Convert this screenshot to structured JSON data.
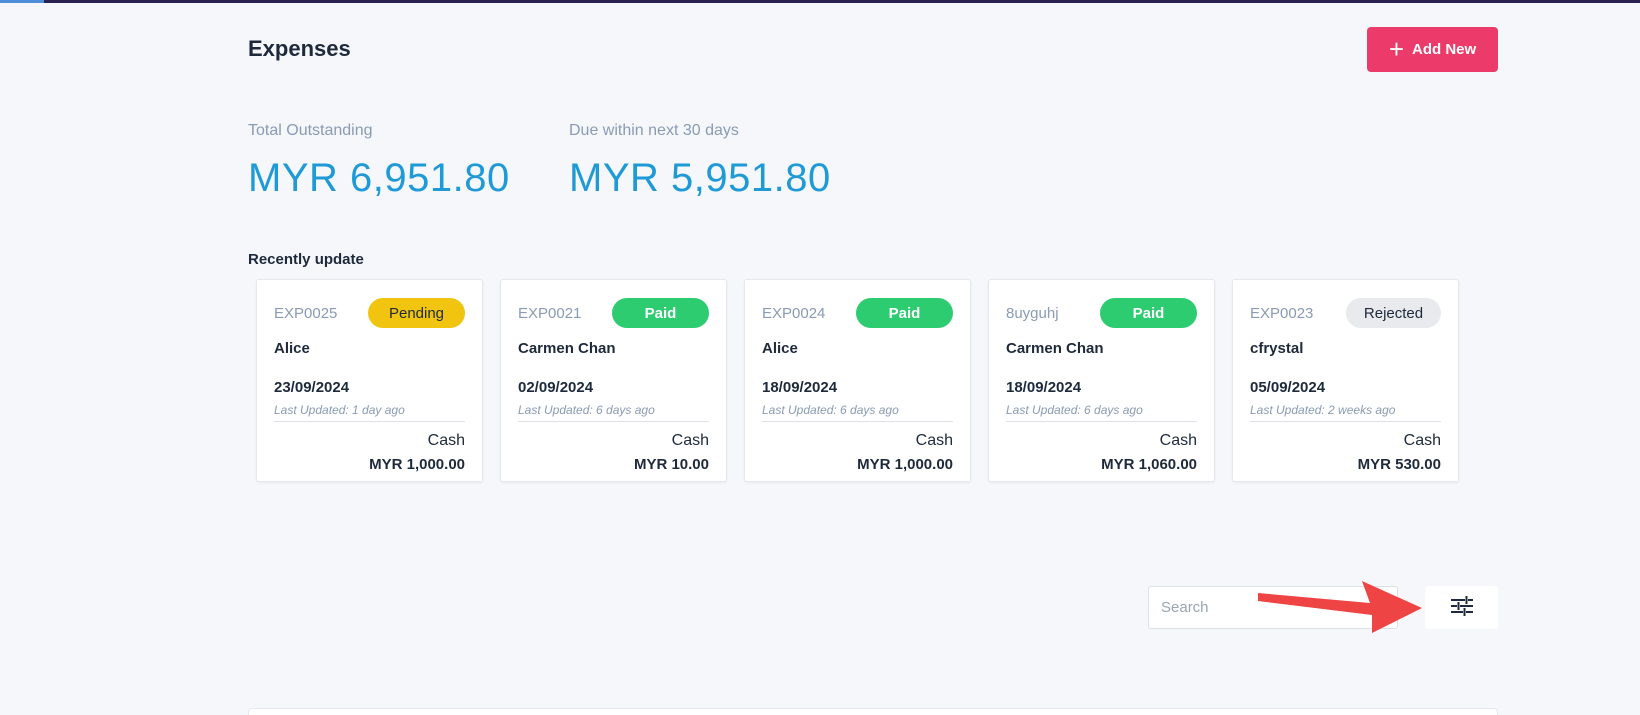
{
  "page": {
    "title": "Expenses",
    "add_label": "Add New"
  },
  "stats": {
    "outstanding_label": "Total Outstanding",
    "outstanding_value": "MYR 6,951.80",
    "due_label": "Due within next 30 days",
    "due_value": "MYR 5,951.80"
  },
  "recent": {
    "title": "Recently update",
    "cards": [
      {
        "id": "EXP0025",
        "status": "Pending",
        "name": "Alice",
        "date": "23/09/2024",
        "updated": "Last Updated: 1 day ago",
        "method": "Cash",
        "amount": "MYR 1,000.00"
      },
      {
        "id": "EXP0021",
        "status": "Paid",
        "name": "Carmen Chan",
        "date": "02/09/2024",
        "updated": "Last Updated: 6 days ago",
        "method": "Cash",
        "amount": "MYR 10.00"
      },
      {
        "id": "EXP0024",
        "status": "Paid",
        "name": "Alice",
        "date": "18/09/2024",
        "updated": "Last Updated: 6 days ago",
        "method": "Cash",
        "amount": "MYR 1,000.00"
      },
      {
        "id": "8uyguhj",
        "status": "Paid",
        "name": "Carmen Chan",
        "date": "18/09/2024",
        "updated": "Last Updated: 6 days ago",
        "method": "Cash",
        "amount": "MYR 1,060.00"
      },
      {
        "id": "EXP0023",
        "status": "Rejected",
        "name": "cfrystal",
        "date": "05/09/2024",
        "updated": "Last Updated: 2 weeks ago",
        "method": "Cash",
        "amount": "MYR 530.00"
      }
    ]
  },
  "search": {
    "placeholder": "Search"
  },
  "icons": {
    "add": "plus-icon",
    "filter": "sliders-icon",
    "annotation": "red-arrow-icon"
  },
  "colors": {
    "accent": "#ec3b6a",
    "stat_value": "#1f9ad6",
    "pending": "#f1c40f",
    "paid": "#2ecc71",
    "rejected": "#e8eaee",
    "annotation_arrow": "#ef4444"
  }
}
